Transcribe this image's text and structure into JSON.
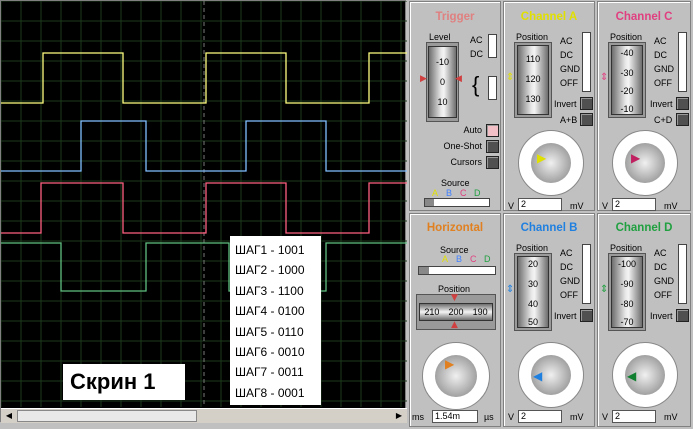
{
  "overlay": {
    "label": "Скрин 1"
  },
  "steps": [
    "ШАГ1 - 1001",
    "ШАГ2 - 1000",
    "ШАГ3 - 1100",
    "ШАГ4 - 0100",
    "ШАГ5 - 0110",
    "ШАГ6 - 0010",
    "ШАГ7 - 0011",
    "ШАГ8 - 0001"
  ],
  "colors": {
    "trace_a": "#ffff80",
    "trace_b": "#80c0ff",
    "trace_c": "#ff6080",
    "trace_d": "#60c080",
    "grid": "#1e3a1e"
  },
  "trigger": {
    "title": "Trigger",
    "level_label": "Level",
    "level_ticks": [
      "-10",
      "0",
      "10"
    ],
    "ac": "AC",
    "dc": "DC",
    "auto": "Auto",
    "one_shot": "One-Shot",
    "cursors": "Cursors",
    "source": "Source",
    "sources": [
      "A",
      "B",
      "C",
      "D"
    ]
  },
  "channel_a": {
    "title": "Channel A",
    "position": "Position",
    "ticks": [
      "110",
      "120",
      "130"
    ],
    "modes": [
      "AC",
      "DC",
      "GND",
      "OFF"
    ],
    "invert": "Invert",
    "extra": "A+B",
    "scale_left": "V",
    "value": "2",
    "unit": "mV"
  },
  "channel_c": {
    "title": "Channel C",
    "position": "Position",
    "ticks": [
      "-40",
      "-30",
      "-20",
      "-10"
    ],
    "modes": [
      "AC",
      "DC",
      "GND",
      "OFF"
    ],
    "invert": "Invert",
    "extra": "C+D",
    "scale_left": "V",
    "value": "2",
    "unit": "mV"
  },
  "horizontal": {
    "title": "Horizontal",
    "source": "Source",
    "sources": [
      "A",
      "B",
      "C",
      "D"
    ],
    "position": "Position",
    "ticks": [
      "210",
      "200",
      "190"
    ],
    "scale_left": "ms",
    "value": "1.54m",
    "unit": "µs"
  },
  "channel_b": {
    "title": "Channel B",
    "position": "Position",
    "ticks": [
      "20",
      "30",
      "40",
      "50"
    ],
    "modes": [
      "AC",
      "DC",
      "GND",
      "OFF"
    ],
    "invert": "Invert",
    "scale_left": "V",
    "value": "2",
    "unit": "mV"
  },
  "channel_d": {
    "title": "Channel D",
    "position": "Position",
    "ticks": [
      "-100",
      "-90",
      "-80",
      "-70"
    ],
    "modes": [
      "AC",
      "DC",
      "GND",
      "OFF"
    ],
    "invert": "Invert",
    "scale_left": "V",
    "value": "2",
    "unit": "mV"
  }
}
